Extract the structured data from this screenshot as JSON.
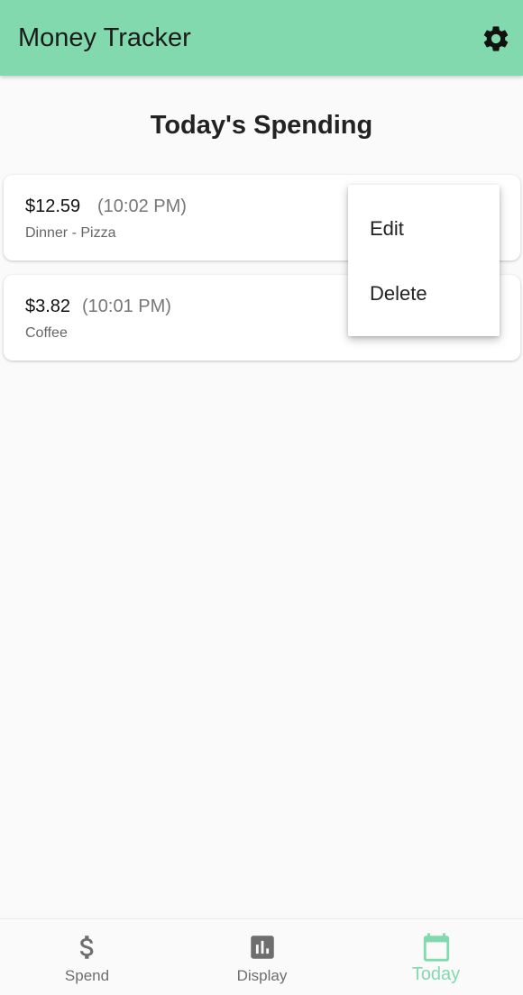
{
  "appbar": {
    "title": "Money Tracker",
    "settings_icon": "gear-icon",
    "color": "#82d9ae"
  },
  "page": {
    "title": "Today's Spending"
  },
  "entries": [
    {
      "amount": "$12.59",
      "time": "(10:02 PM)",
      "description": "Dinner - Pizza"
    },
    {
      "amount": "$3.82",
      "time": "(10:01 PM)",
      "description": "Coffee"
    }
  ],
  "context_menu": {
    "items": [
      {
        "label": "Edit"
      },
      {
        "label": "Delete"
      }
    ]
  },
  "bottom_nav": {
    "items": [
      {
        "label": "Spend",
        "icon": "dollar-icon",
        "active": false
      },
      {
        "label": "Display",
        "icon": "bar-chart-icon",
        "active": false
      },
      {
        "label": "Today",
        "icon": "calendar-icon",
        "active": true
      }
    ],
    "active_color": "#82d9ae",
    "inactive_color": "#6e6e6e"
  }
}
